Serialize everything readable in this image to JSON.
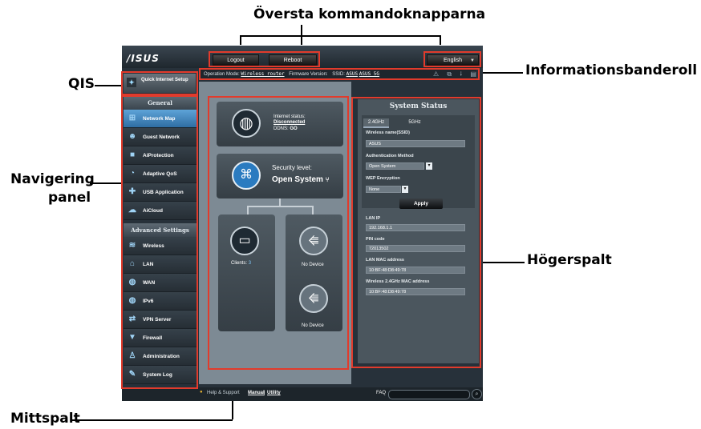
{
  "callouts": {
    "top_commands": "Översta kommandoknapparna",
    "info_banner": "Informationsbanderoll",
    "qis": "QIS",
    "nav_panel_line1": "Navigering",
    "nav_panel_line2": "panel",
    "right_column": "Högerspalt",
    "middle_column": "Mittspalt"
  },
  "header": {
    "logo": "/ISUS",
    "logout": "Logout",
    "reboot": "Reboot",
    "language": "English"
  },
  "info": {
    "op_mode_label": "Operation Mode:",
    "op_mode_value": "Wireless router",
    "fw_label": "Firmware Version:",
    "ssid_label": "SSID:",
    "ssid_1": "ASUS",
    "ssid_2": "ASUS_5G",
    "status_icons": "⚠ ⧉ ⭭ ▤"
  },
  "qis": {
    "label": "Quick Internet Setup",
    "icon": "wand-icon"
  },
  "nav": {
    "general_header": "General",
    "general": [
      {
        "label": "Network Map",
        "icon": "network-map-icon",
        "glyph": "⊞",
        "active": true
      },
      {
        "label": "Guest Network",
        "icon": "guest-icon",
        "glyph": "☻"
      },
      {
        "label": "AiProtection",
        "icon": "lock-icon",
        "glyph": "■"
      },
      {
        "label": "Adaptive QoS",
        "icon": "gauge-icon",
        "glyph": "◔"
      },
      {
        "label": "USB Application",
        "icon": "puzzle-icon",
        "glyph": "✚"
      },
      {
        "label": "AiCloud",
        "icon": "cloud-icon",
        "glyph": "☁"
      }
    ],
    "advanced_header": "Advanced Settings",
    "advanced": [
      {
        "label": "Wireless",
        "icon": "wifi-icon",
        "glyph": "≋"
      },
      {
        "label": "LAN",
        "icon": "home-icon",
        "glyph": "⌂"
      },
      {
        "label": "WAN",
        "icon": "globe-icon",
        "glyph": "◍"
      },
      {
        "label": "IPv6",
        "icon": "ipv6-icon",
        "glyph": "◍"
      },
      {
        "label": "VPN Server",
        "icon": "vpn-icon",
        "glyph": "⇄"
      },
      {
        "label": "Firewall",
        "icon": "shield-icon",
        "glyph": "▼"
      },
      {
        "label": "Administration",
        "icon": "user-icon",
        "glyph": "♙"
      },
      {
        "label": "System Log",
        "icon": "log-icon",
        "glyph": "✎"
      }
    ]
  },
  "center": {
    "internet_status_label": "Internet status:",
    "internet_status_value": "Disconnected",
    "ddns_label": "DDNS:",
    "ddns_value": "GO",
    "security_label": "Security level:",
    "security_value": "Open System",
    "clients_label": "Clients:",
    "clients_count": "3",
    "usb1": "No Device",
    "usb2": "No Device"
  },
  "system_status": {
    "title": "System Status",
    "tab_24": "2.4GHz",
    "tab_5": "5GHz",
    "ssid_label": "Wireless name(SSID)",
    "ssid_value": "ASUS",
    "auth_label": "Authentication Method",
    "auth_value": "Open System",
    "wep_label": "WEP Encryption",
    "wep_value": "None",
    "apply": "Apply",
    "lan_ip_label": "LAN IP",
    "lan_ip_value": "192.168.1.1",
    "pin_label": "PIN code",
    "pin_value": "72013502",
    "lan_mac_label": "LAN MAC address",
    "lan_mac_value": "10:BF:48:D8:49:78",
    "wl_mac_label": "Wireless 2.4GHz MAC address",
    "wl_mac_value": "10:BF:48:D8:49:78"
  },
  "footer": {
    "help": "Help & Support",
    "manual": "Manual",
    "sep": "|",
    "utility": "Utility",
    "faq": "FAQ"
  },
  "colors": {
    "highlight": "#e23b2c",
    "active_nav": "#3b82c0"
  }
}
